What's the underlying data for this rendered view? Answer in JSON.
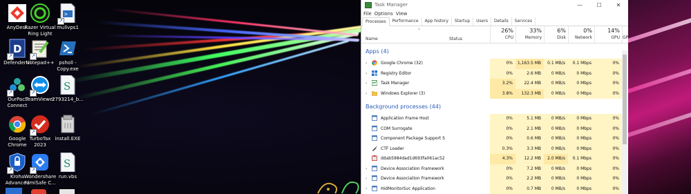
{
  "desktop": {
    "icons": [
      {
        "label": "AnyDesk"
      },
      {
        "label": "Razer Virtual Ring Light"
      },
      {
        "label": "mullvps1"
      },
      {
        "label": "DefenderUI"
      },
      {
        "label": "Notepad++"
      },
      {
        "label": "psholl - Copy.exe"
      },
      {
        "label": "OurPact Connect"
      },
      {
        "label": "TeamViewer"
      },
      {
        "label": "2793214_b..."
      },
      {
        "label": "Google Chrome"
      },
      {
        "label": "TurboTax 2023"
      },
      {
        "label": "install.EXE"
      },
      {
        "label": "Kroha Advanced"
      },
      {
        "label": "Wondershare FamiSafe C..."
      },
      {
        "label": "run.vbs"
      }
    ]
  },
  "taskmanager": {
    "title": "Task Manager",
    "window_buttons": {
      "minimize": "—",
      "maximize": "☐",
      "close": "✕"
    },
    "menu": [
      "File",
      "Options",
      "View"
    ],
    "tabs": [
      "Processes",
      "Performance",
      "App history",
      "Startup",
      "Users",
      "Details",
      "Services"
    ],
    "active_tab": "Processes",
    "headers": {
      "name": "Name",
      "status": "Status",
      "cpu": {
        "percent": "26%",
        "label": "CPU"
      },
      "memory": {
        "percent": "33%",
        "label": "Memory"
      },
      "disk": {
        "percent": "6%",
        "label": "Disk"
      },
      "network": {
        "percent": "0%",
        "label": "Network"
      },
      "gpu": {
        "percent": "14%",
        "label": "GPU"
      },
      "gpu_engine": {
        "label": "GP"
      }
    },
    "groups": [
      {
        "title": "Apps (4)",
        "rows": [
          {
            "name": "Google Chrome (32)",
            "icon": "chrome-icon",
            "expand": "›",
            "cpu": "0%",
            "memory": "1,163.5 MB",
            "disk": "0.1 MB/s",
            "network": "0.1 Mbps",
            "gpu": "0%"
          },
          {
            "name": "Registry Editor",
            "icon": "registry-editor-icon",
            "expand": "›",
            "cpu": "0%",
            "memory": "2.6 MB",
            "disk": "0 MB/s",
            "network": "0 Mbps",
            "gpu": "0%"
          },
          {
            "name": "Task Manager",
            "icon": "task-manager-icon",
            "expand": "›",
            "cpu": "3.2%",
            "memory": "22.4 MB",
            "disk": "0 MB/s",
            "network": "0 Mbps",
            "gpu": "0%"
          },
          {
            "name": "Windows Explorer (3)",
            "icon": "file-explorer-icon",
            "expand": "›",
            "cpu": "3.8%",
            "memory": "132.3 MB",
            "disk": "0 MB/s",
            "network": "0 Mbps",
            "gpu": "0%"
          }
        ]
      },
      {
        "title": "Background processes (44)",
        "rows": [
          {
            "name": "Application Frame Host",
            "icon": "app-window-icon",
            "expand": "",
            "cpu": "0%",
            "memory": "5.1 MB",
            "disk": "0 MB/s",
            "network": "0 Mbps",
            "gpu": "0%"
          },
          {
            "name": "COM Surrogate",
            "icon": "app-window-icon",
            "expand": "",
            "cpu": "0%",
            "memory": "2.1 MB",
            "disk": "0 MB/s",
            "network": "0 Mbps",
            "gpu": "0%"
          },
          {
            "name": "Component Package Support S...",
            "icon": "app-window-icon",
            "expand": "",
            "cpu": "0%",
            "memory": "0.6 MB",
            "disk": "0 MB/s",
            "network": "0 Mbps",
            "gpu": "0%"
          },
          {
            "name": "CTF Loader",
            "icon": "ctf-loader-icon",
            "expand": "",
            "cpu": "0.3%",
            "memory": "3.3 MB",
            "disk": "0 MB/s",
            "network": "0 Mbps",
            "gpu": "0%"
          },
          {
            "name": "ddab5984dad1d693fa061ac52e...",
            "icon": "setup-icon",
            "expand": "",
            "cpu": "4.3%",
            "memory": "12.2 MB",
            "disk": "2.0 MB/s",
            "network": "0.1 Mbps",
            "gpu": "0%"
          },
          {
            "name": "Device Association Framework P...",
            "icon": "app-window-icon",
            "expand": "›",
            "cpu": "0%",
            "memory": "7.2 MB",
            "disk": "0 MB/s",
            "network": "0 Mbps",
            "gpu": "0%"
          },
          {
            "name": "Device Association Framework P...",
            "icon": "app-window-icon",
            "expand": "›",
            "cpu": "0%",
            "memory": "2.2 MB",
            "disk": "0 MB/s",
            "network": "0 Mbps",
            "gpu": "0%"
          },
          {
            "name": "HidMonitorSvc Application",
            "icon": "app-window-icon",
            "expand": "›",
            "cpu": "0%",
            "memory": "0.7 MB",
            "disk": "0 MB/s",
            "network": "0 Mbps",
            "gpu": "0%"
          }
        ]
      }
    ]
  }
}
